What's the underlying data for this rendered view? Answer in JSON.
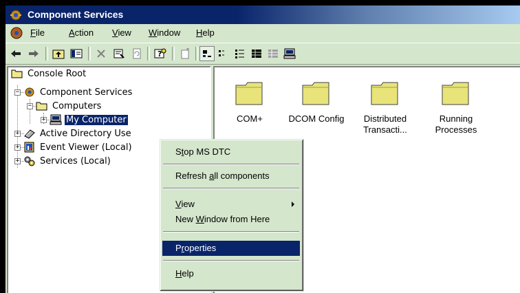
{
  "window": {
    "title": "Component Services"
  },
  "menu": [
    {
      "label": "File",
      "accel": "F",
      "rest": "ile"
    },
    {
      "label": "Action",
      "accel": "A",
      "rest": "ction"
    },
    {
      "label": "View",
      "accel": "V",
      "rest": "iew"
    },
    {
      "label": "Window",
      "accel": "W",
      "rest": "indow"
    },
    {
      "label": "Help",
      "accel": "H",
      "rest": "elp"
    }
  ],
  "toolbar": {
    "icons": [
      "back-icon",
      "forward-icon",
      "up-folder-icon",
      "show-hide-tree-icon",
      "delete-icon",
      "properties-icon",
      "refresh-icon",
      "help-icon",
      "new-item-icon",
      "large-icons-icon",
      "small-icons-icon",
      "list-view-icon",
      "details-view-icon",
      "grid-icon",
      "computer-icon"
    ]
  },
  "tree": {
    "console_root": "Console Root",
    "component_services": "Component Services",
    "computers": "Computers",
    "my_computer": "My Computer",
    "active_directory": "Active Directory Use",
    "event_viewer": "Event Viewer (Local)",
    "services": "Services (Local)"
  },
  "items": [
    {
      "line1": "COM+",
      "line2": ""
    },
    {
      "line1": "DCOM Config",
      "line2": ""
    },
    {
      "line1": "Distributed",
      "line2": "Transacti..."
    },
    {
      "line1": "Running",
      "line2": "Processes"
    }
  ],
  "context_menu": {
    "stop": {
      "pre": "S",
      "accel": "t",
      "post": "op MS DTC"
    },
    "refresh": {
      "pre": "Refresh ",
      "accel": "a",
      "post": "ll components"
    },
    "view": {
      "pre": "",
      "accel": "V",
      "post": "iew"
    },
    "new_window": {
      "pre": "New ",
      "accel": "W",
      "post": "indow from Here"
    },
    "properties": {
      "pre": "P",
      "accel": "r",
      "post": "operties"
    },
    "help": {
      "pre": "",
      "accel": "H",
      "post": "elp"
    }
  },
  "colors": {
    "highlight": "#0a246a",
    "chrome": "#d4e6cc",
    "folder": "#e8e47a"
  }
}
